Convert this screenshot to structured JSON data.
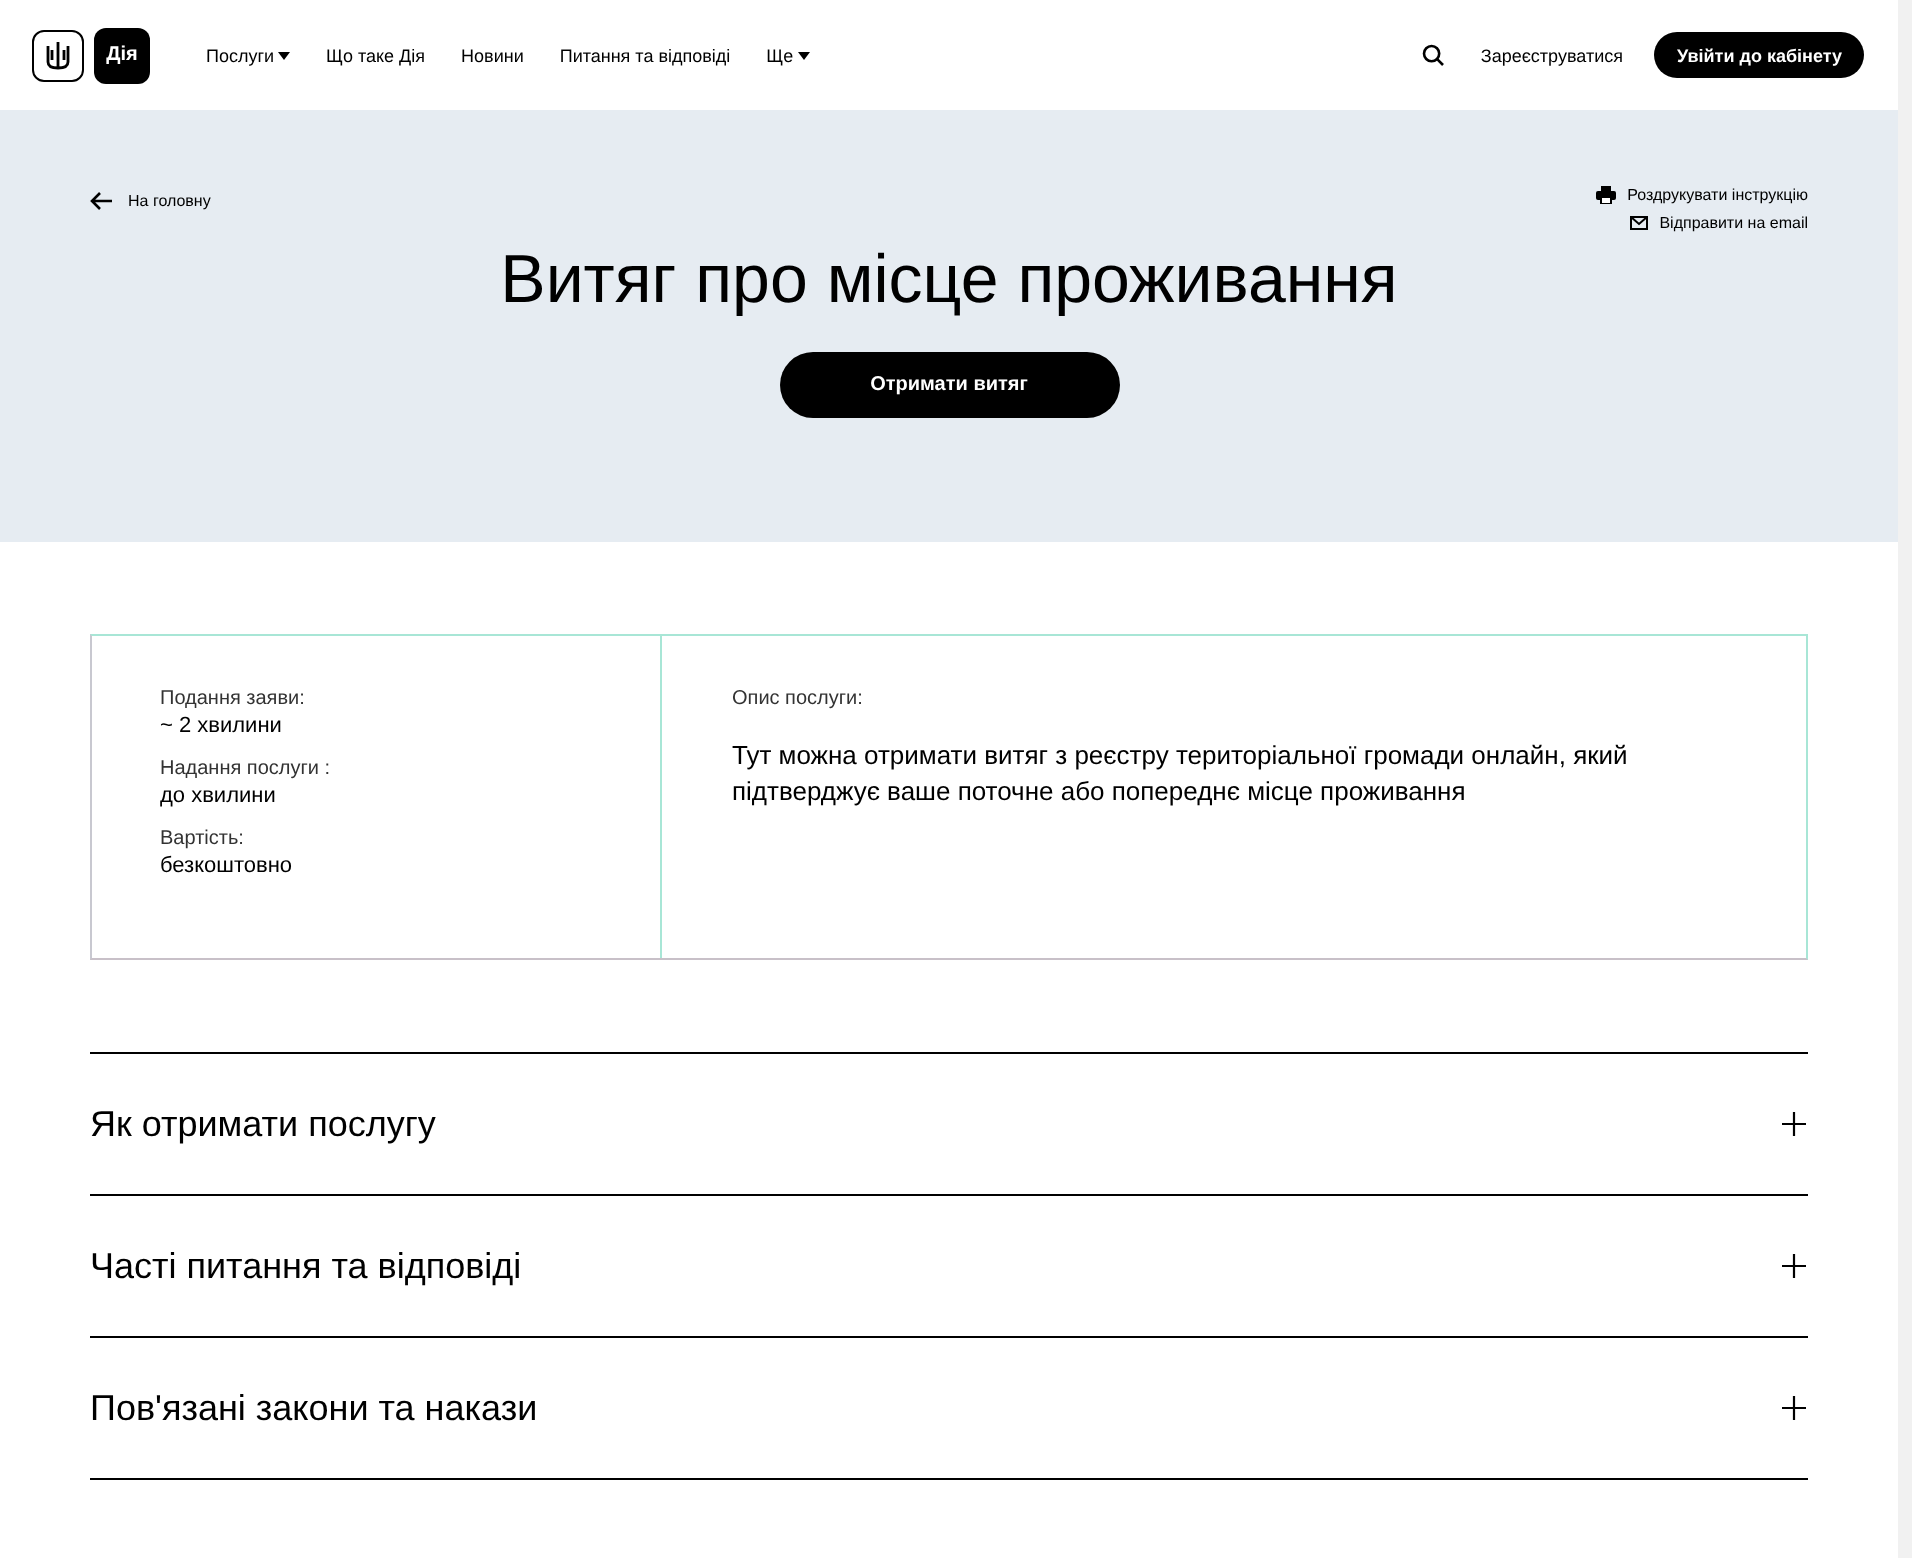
{
  "header": {
    "logo_text": "Дія",
    "nav": [
      {
        "label": "Послуги",
        "dropdown": true
      },
      {
        "label": "Що таке Дія",
        "dropdown": false
      },
      {
        "label": "Новини",
        "dropdown": false
      },
      {
        "label": "Питання та відповіді",
        "dropdown": false
      },
      {
        "label": "Ще",
        "dropdown": true
      }
    ],
    "register": "Зареєструватися",
    "login": "Увійти до кабінету"
  },
  "hero": {
    "back": "На головну",
    "print": "Роздрукувати інструкцію",
    "email": "Відправити на email",
    "title": "Витяг про місце проживання",
    "cta": "Отримати витяг"
  },
  "info": {
    "facts": [
      {
        "label": "Подання заяви:",
        "value": "~ 2 хвилини"
      },
      {
        "label": "Надання послуги :",
        "value": "до хвилини"
      },
      {
        "label": "Вартість:",
        "value": "безкоштовно"
      }
    ],
    "description_label": "Опис послуги:",
    "description": "Тут можна отримати витяг з реєстру територіальної громади онлайн, який підтверджує ваше поточне або попереднє місце проживання"
  },
  "accordion": [
    {
      "title": "Як отримати послугу",
      "expanded": false
    },
    {
      "title": "Часті питання та відповіді",
      "expanded": false
    },
    {
      "title": "Пов'язані закони та накази",
      "expanded": false
    }
  ]
}
